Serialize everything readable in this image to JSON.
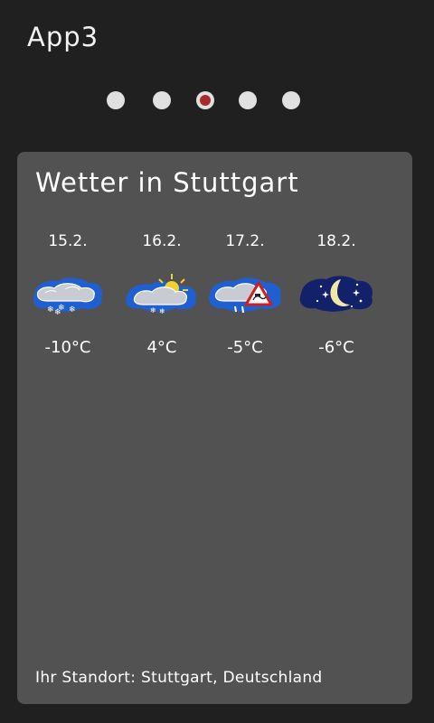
{
  "app": {
    "title": "App3"
  },
  "pager": {
    "count": 5,
    "active_index": 2
  },
  "weather": {
    "title": "Wetter in Stuttgart",
    "days": [
      {
        "date": "15.2.",
        "icon": "snow-cloud-icon",
        "temp": "-10°C"
      },
      {
        "date": "16.2.",
        "icon": "sun-snow-cloud-icon",
        "temp": "4°C"
      },
      {
        "date": "17.2.",
        "icon": "freezing-rain-warning-icon",
        "temp": "-5°C"
      },
      {
        "date": "18.2.",
        "icon": "clear-night-moon-icon",
        "temp": "-6°C"
      }
    ],
    "location": "Ihr Standort: Stuttgart, Deutschland"
  },
  "colors": {
    "background": "#202020",
    "card": "#525252",
    "dot": "#e0e0e0",
    "dot_active": "#a82a2a",
    "icon_backdrop": "#1f5fd0",
    "night_backdrop": "#13206a"
  }
}
